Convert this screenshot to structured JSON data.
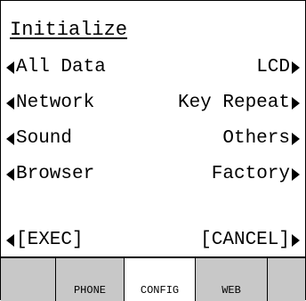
{
  "screen": {
    "title": "Initialize"
  },
  "menu": {
    "rows": [
      {
        "left": "All Data",
        "right": "LCD"
      },
      {
        "left": "Network",
        "right": "Key Repeat"
      },
      {
        "left": "Sound",
        "right": "Others"
      },
      {
        "left": "Browser",
        "right": "Factory"
      }
    ],
    "exec_label": "[EXEC]",
    "cancel_label": "[CANCEL]"
  },
  "softkeys": [
    {
      "label": ""
    },
    {
      "label": "PHONE"
    },
    {
      "label": "CONFIG",
      "active": true
    },
    {
      "label": "WEB"
    },
    {
      "label": ""
    }
  ]
}
